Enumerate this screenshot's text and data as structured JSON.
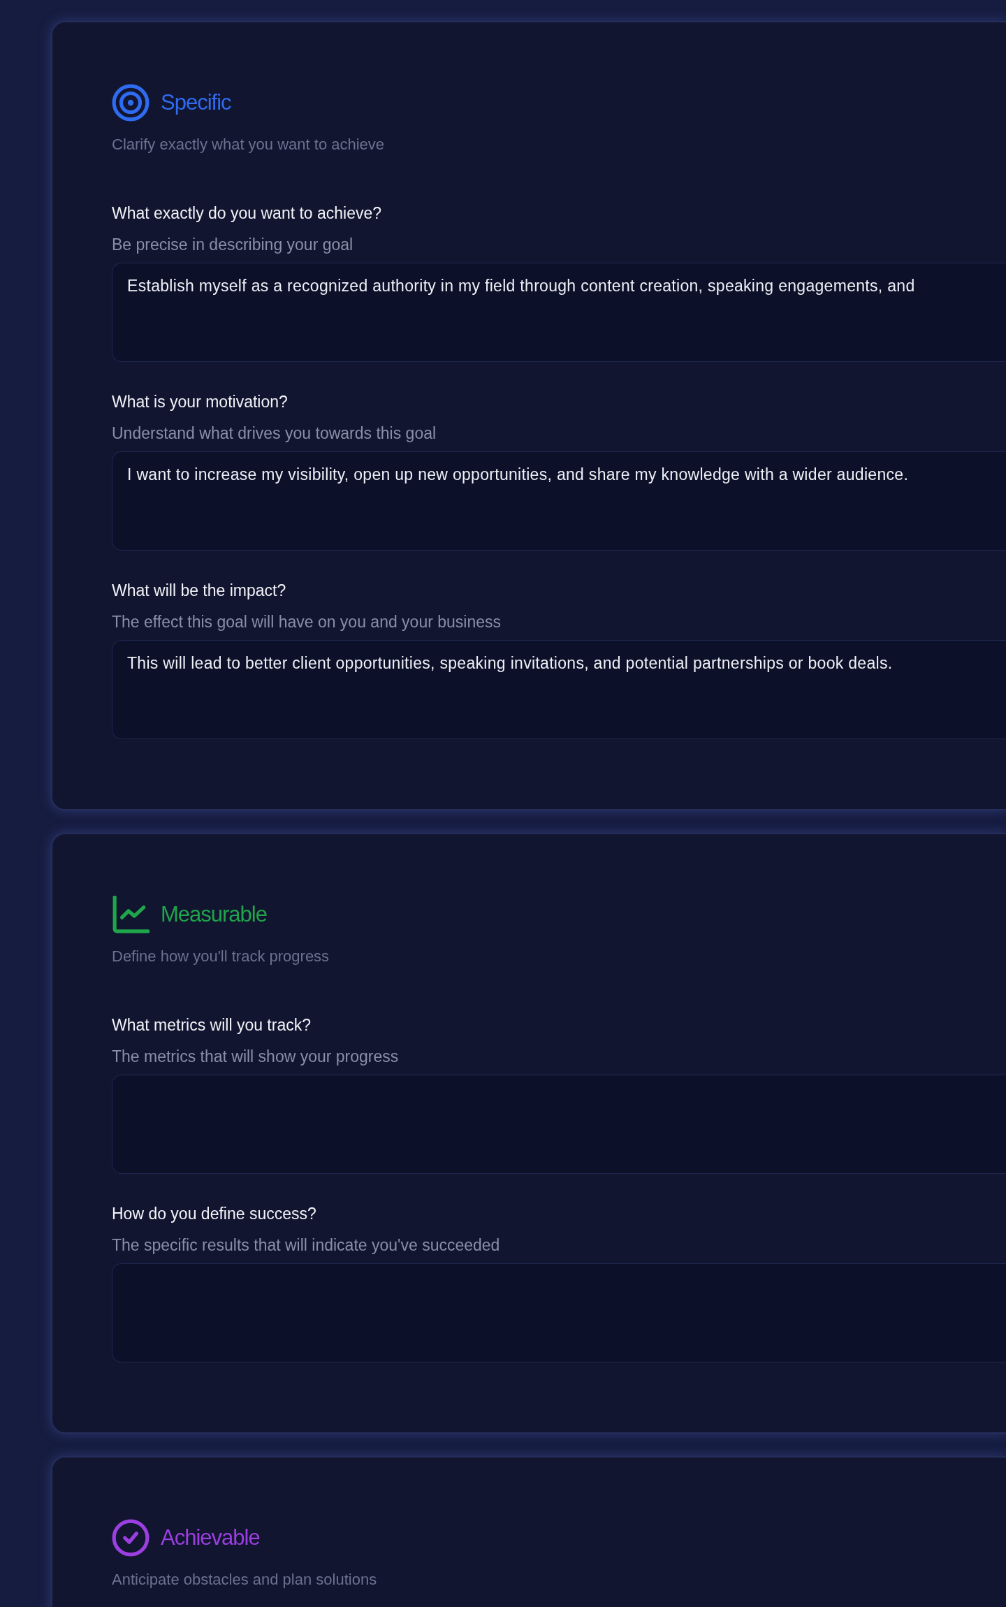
{
  "sections": [
    {
      "kind": "target",
      "color": "#2f6bf0",
      "title": "Specific",
      "subtitle": "Clarify exactly what you want to achieve",
      "fields": [
        {
          "label": "What exactly do you want to achieve?",
          "hint": "Be precise in describing your goal",
          "value": "Establish myself as a recognized authority in my field through content creation, speaking engagements, and"
        },
        {
          "label": "What is your motivation?",
          "hint": "Understand what drives you towards this goal",
          "value": "I want to increase my visibility, open up new opportunities, and share my knowledge with a wider audience."
        },
        {
          "label": "What will be the impact?",
          "hint": "The effect this goal will have on you and your business",
          "value": "This will lead to better client opportunities, speaking invitations, and potential partnerships or book deals."
        }
      ]
    },
    {
      "kind": "chart",
      "color": "#1fa54a",
      "title": "Measurable",
      "subtitle": "Define how you'll track progress",
      "fields": [
        {
          "label": "What metrics will you track?",
          "hint": "The metrics that will show your progress"
        },
        {
          "label": "How do you define success?",
          "hint": "The specific results that will indicate you've succeeded"
        }
      ]
    },
    {
      "kind": "check",
      "color": "#9b3fe0",
      "title": "Achievable",
      "subtitle": "Anticipate obstacles and plan solutions"
    }
  ]
}
